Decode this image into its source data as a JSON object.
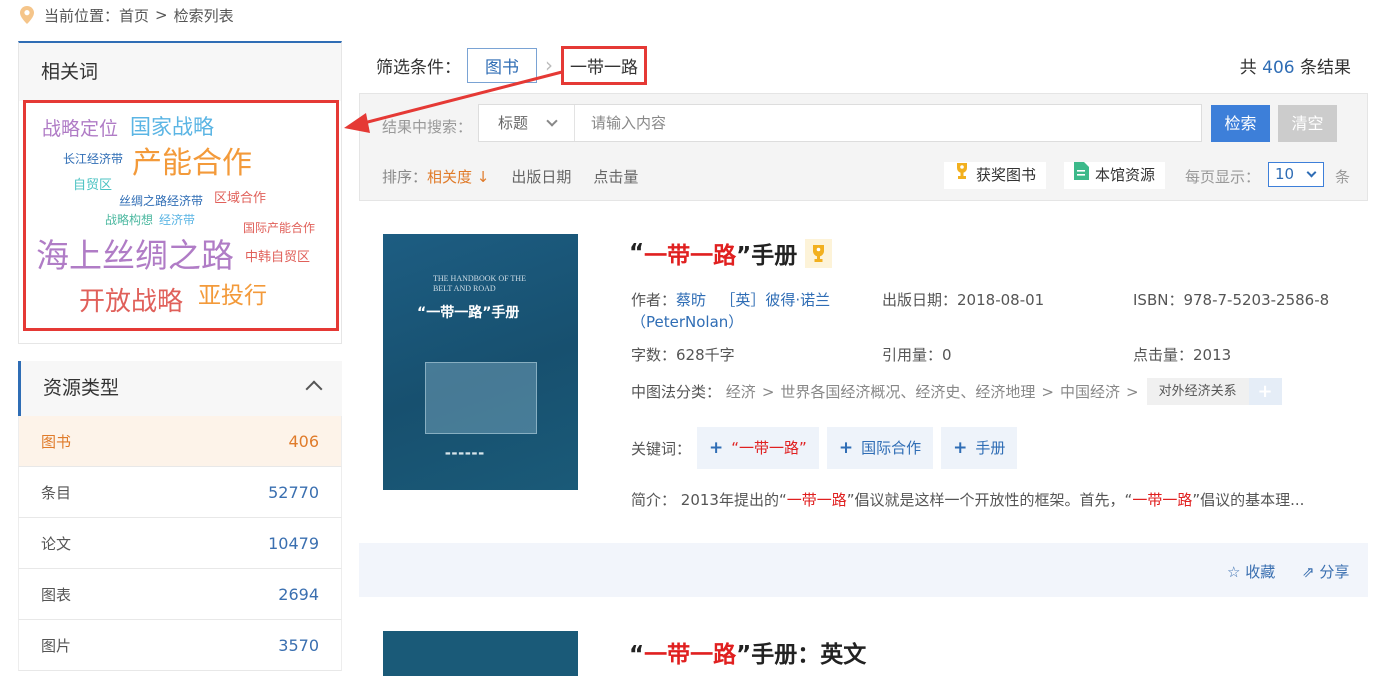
{
  "breadcrumb": {
    "prefix": "当前位置：",
    "home": "首页",
    "sep": ">",
    "current": "检索列表"
  },
  "related": {
    "title": "相关词",
    "words": [
      {
        "text": "战略定位",
        "color": "#b07cc6"
      },
      {
        "text": "国家战略",
        "color": "#5bb5e4"
      },
      {
        "text": "长江经济带",
        "color": "#2f6db5"
      },
      {
        "text": "产能合作",
        "color": "#f39a3a"
      },
      {
        "text": "自贸区",
        "color": "#4cc3c3"
      },
      {
        "text": "丝绸之路经济带",
        "color": "#2f6db5"
      },
      {
        "text": "区域合作",
        "color": "#e0605a"
      },
      {
        "text": "战略构想",
        "color": "#4cb8a0"
      },
      {
        "text": "经济带",
        "color": "#5bb5e4"
      },
      {
        "text": "国际产能合作",
        "color": "#e0605a"
      },
      {
        "text": "海上丝绸之路",
        "color": "#b07cc6"
      },
      {
        "text": "中韩自贸区",
        "color": "#e0605a"
      },
      {
        "text": "开放战略",
        "color": "#e0605a"
      },
      {
        "text": "亚投行",
        "color": "#f39a3a"
      }
    ]
  },
  "resources": {
    "title": "资源类型",
    "items": [
      {
        "label": "图书",
        "count": "406"
      },
      {
        "label": "条目",
        "count": "52770"
      },
      {
        "label": "论文",
        "count": "10479"
      },
      {
        "label": "图表",
        "count": "2694"
      },
      {
        "label": "图片",
        "count": "3570"
      }
    ]
  },
  "filter": {
    "label": "筛选条件：",
    "type": "图书",
    "keyword": "一带一路",
    "total_prefix": "共",
    "total": "406",
    "total_suffix": "条结果"
  },
  "search": {
    "label": "结果中搜索：",
    "field": "标题",
    "placeholder": "请输入内容",
    "search_btn": "检索",
    "clear_btn": "清空"
  },
  "sort": {
    "label": "排序：",
    "options": [
      "相关度",
      "出版日期",
      "点击量"
    ],
    "award_btn": "获奖图书",
    "local_btn": "本馆资源",
    "per_page_label": "每页显示：",
    "per_page": "10",
    "per_page_unit": "条"
  },
  "records": [
    {
      "title_open": "“",
      "title_kw": "一带一路",
      "title_rest": "”手册",
      "cover_en": "THE HANDBOOK OF THE BELT AND ROAD",
      "cover_cn": "“一带一路”手册",
      "author_label": "作者：",
      "author1": "蔡昉",
      "author2": "［英］彼得·诺兰（PeterNolan）",
      "date_label": "出版日期：",
      "date": "2018-08-01",
      "isbn_label": "ISBN：",
      "isbn": "978-7-5203-2586-8",
      "words_label": "字数：",
      "words": "628千字",
      "cite_label": "引用量：",
      "cite": "0",
      "clicks_label": "点击量：",
      "clicks": "2013",
      "cls_label": "中图法分类：",
      "cls": [
        "经济",
        "世界各国经济概况、经济史、经济地理",
        "中国经济"
      ],
      "cls_last": "对外经济关系",
      "kw_label": "关键词：",
      "keywords": [
        "“一带一路”",
        "国际合作",
        "手册"
      ],
      "summary_label": "简介：",
      "summary_a": "2013年提出的“",
      "summary_kw1": "一带一路",
      "summary_b": "”倡议就是这样一个开放性的框架。首先，“",
      "summary_kw2": "一带一路",
      "summary_c": "”倡议的基本理...",
      "fav": "收藏",
      "share": "分享"
    },
    {
      "title_open": "“",
      "title_kw": "一带一路",
      "title_rest": "”手册：英文"
    }
  ],
  "colors": {
    "accent": "#2f6db5",
    "highlight": "#e02020",
    "orange": "#e07b2a",
    "annotation": "#e53935"
  }
}
